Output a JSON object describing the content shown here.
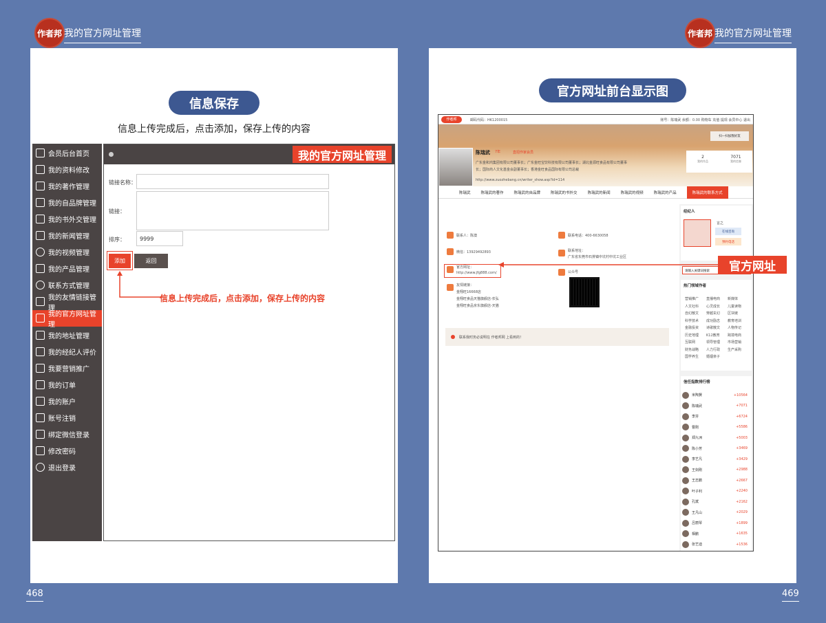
{
  "header": {
    "left_logo": "作者邦",
    "left_title": "我的官方网址管理",
    "right_logo": "作者邦",
    "right_title": "我的官方网址管理"
  },
  "left_page": {
    "pill": "信息保存",
    "subtitle": "信息上传完成后，点击添加，保存上传的内容",
    "panel_banner": "我的官方网址管理",
    "sidebar": [
      {
        "label": "会员后台首页",
        "icon": "home-icon"
      },
      {
        "label": "我的资料修改",
        "icon": "edit-icon"
      },
      {
        "label": "我的著作管理",
        "icon": "book-icon"
      },
      {
        "label": "我的自品牌管理",
        "icon": "camera-icon"
      },
      {
        "label": "我的书外交管理",
        "icon": "handshake-icon"
      },
      {
        "label": "我的新闻管理",
        "icon": "news-icon"
      },
      {
        "label": "我的视频管理",
        "icon": "play-icon"
      },
      {
        "label": "我的产品管理",
        "icon": "hand-icon"
      },
      {
        "label": "联系方式管理",
        "icon": "phone-icon"
      },
      {
        "label": "我的友情链接管理",
        "icon": "hand-icon"
      },
      {
        "label": "我的官方网址管理",
        "icon": "hand-icon",
        "active": true
      },
      {
        "label": "我的地址管理",
        "icon": "hand-icon"
      },
      {
        "label": "我的经纪人评价",
        "icon": "handshake-icon"
      },
      {
        "label": "我要营销推广",
        "icon": "checkbox-icon"
      },
      {
        "label": "我的订单",
        "icon": "cart-icon"
      },
      {
        "label": "我的账户",
        "icon": "yen-icon"
      },
      {
        "label": "账号注销",
        "icon": "doc-icon"
      },
      {
        "label": "绑定微信登录",
        "icon": "doc-icon"
      },
      {
        "label": "修改密码",
        "icon": "doc-icon"
      },
      {
        "label": "退出登录",
        "icon": "user-icon"
      }
    ],
    "form": {
      "name_label": "链接名称：",
      "link_label": "链接：",
      "order_label": "排序：",
      "order_value": "9999",
      "add_button": "添加",
      "back_button": "返回"
    },
    "annotation": "信息上传完成后，点击添加，保存上传的内容",
    "page_number": "468"
  },
  "right_page": {
    "pill": "官方网址前台显示图",
    "site": {
      "logo": "作者邦",
      "top_code": "邮码代码：HK1200015",
      "top_right": "账号：陈瑞武  余额：0.00  购物车  充值  提现  会员中心  退出",
      "scan_label": "扫一扫加我好友",
      "author_name": "陈瑞武",
      "vip_badge": "7年",
      "tag": "直招作家会员",
      "bio1": "广东金和鸿集团有限公司董事长；广东金旺宝饮科技有限公司董事长；湖北金源旺食品有限公司董事",
      "bio2": "长；国际商人文化基金会副董事长；香港金旺食品国际有限公司总裁",
      "url": "http://www.zuozhebang.cn/writer_show.asp?id=114",
      "stat1_value": "2",
      "stat1_label": "我的作品",
      "stat2_value": "7071",
      "stat2_label": "我的信誉",
      "tabs": [
        "陈瑞武",
        "陈瑞武的著作",
        "陈瑞武的自品牌",
        "陈瑞武的书外交",
        "陈瑞武的新闻",
        "陈瑞武的视频",
        "陈瑞武的产品",
        "陈瑞武的联系方式"
      ],
      "contact_label": "联系人：陈澳",
      "phone_label": "联系电话：400-6630058",
      "wechat_label": "微信：13929492893",
      "address_title": "联系地址：",
      "address_value": "广东省东莞市石排镇中坑村中坑工业区",
      "official_title": "官方网址：",
      "official_value": "http://www.jfg888.com/",
      "public_label": "公众号",
      "friend_title": "友情链接：",
      "friend_links": [
        "金翔旺16668店",
        "金翔旺食品天猫旗舰店-农弘",
        "金翔旺食品京东旗舰店-天猫"
      ],
      "notice": "联系我时务必说明在 作者邦网 上看到的！",
      "broker_title": "经纪人",
      "broker_name": "言之",
      "broker_btn1": "在线咨询",
      "broker_btn2": "预约电话",
      "search_placeholder": "请输入关键词搜索",
      "hot_title": "热门领域作者",
      "hot_fields": [
        "营销推广",
        "直播电商",
        "新媒体",
        "人文社科",
        "心灵成长",
        "儿童读物",
        "自幻散文",
        "穿越玄幻",
        "区块链",
        "科学技术",
        "成功励志",
        "教育培训",
        "金融投资",
        "诗歌散文",
        "人物传记",
        "历史地理",
        "K12教育",
        "跨境电商",
        "互联网",
        "领导管理",
        "市场营销",
        "财务战略",
        "人力行政",
        "生产采购",
        "国学养生",
        "婚姻亲子"
      ],
      "rank_title": "信任指数排行榜",
      "ranking": [
        {
          "name": "米陶賢",
          "score": "+10564"
        },
        {
          "name": "陈瑞武",
          "score": "+7071"
        },
        {
          "name": "李芬",
          "score": "+6724"
        },
        {
          "name": "曹刚",
          "score": "+5586"
        },
        {
          "name": "郑九洲",
          "score": "+5003"
        },
        {
          "name": "陈小芳",
          "score": "+3469"
        },
        {
          "name": "李艺凡",
          "score": "+3429"
        },
        {
          "name": "王剑刚",
          "score": "+2988"
        },
        {
          "name": "王志鹏",
          "score": "+2667"
        },
        {
          "name": "叶子利",
          "score": "+2240"
        },
        {
          "name": "孔斌",
          "score": "+2162"
        },
        {
          "name": "王凡山",
          "score": "+2029"
        },
        {
          "name": "吕丽琴",
          "score": "+1899"
        },
        {
          "name": "相鹏",
          "score": "+1635"
        },
        {
          "name": "张艺迪",
          "score": "+1536"
        }
      ]
    },
    "callout": "官方网址",
    "page_number": "469"
  },
  "colors": {
    "background": "#5e79ad",
    "accent": "#e8432b",
    "pill": "#3d5891",
    "sidebar": "#4a4444"
  }
}
